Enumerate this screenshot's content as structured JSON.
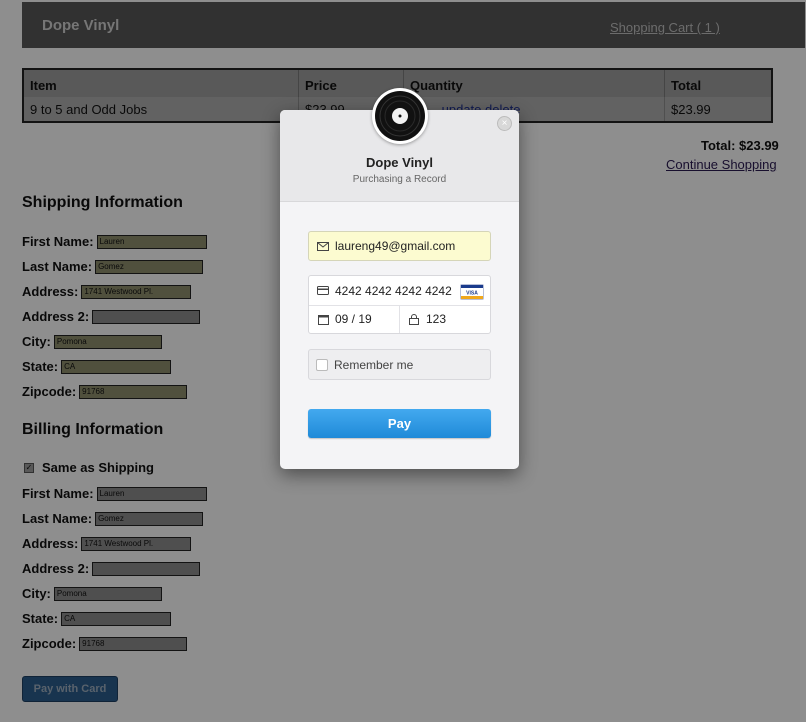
{
  "header": {
    "brand": "Dope Vinyl",
    "cart_link": "Shopping Cart ( 1 )"
  },
  "cart": {
    "columns": [
      "Item",
      "Price",
      "Quantity",
      "Total"
    ],
    "rows": [
      {
        "item": "9 to 5 and Odd Jobs",
        "price": "$23.99",
        "qty_update": "update",
        "qty_delete": "delete",
        "total": "$23.99"
      }
    ],
    "grand_total": "Total: $23.99",
    "continue_link": "Continue Shopping"
  },
  "shipping": {
    "title": "Shipping Information",
    "fields": [
      {
        "label": "First Name:",
        "value": "Lauren"
      },
      {
        "label": "Last Name:",
        "value": "Gomez"
      },
      {
        "label": "Address:",
        "value": "1741 Westwood Pl."
      },
      {
        "label": "Address 2:",
        "value": ""
      },
      {
        "label": "City:",
        "value": "Pomona"
      },
      {
        "label": "State:",
        "value": "CA"
      },
      {
        "label": "Zipcode:",
        "value": "91768"
      }
    ]
  },
  "billing": {
    "title": "Billing Information",
    "same_as_shipping": "Same as Shipping",
    "same_checked": true,
    "fields": [
      {
        "label": "First Name:",
        "value": "Lauren"
      },
      {
        "label": "Last Name:",
        "value": "Gomez"
      },
      {
        "label": "Address:",
        "value": "1741 Westwood Pl."
      },
      {
        "label": "Address 2:",
        "value": ""
      },
      {
        "label": "City:",
        "value": "Pomona"
      },
      {
        "label": "State:",
        "value": "CA"
      },
      {
        "label": "Zipcode:",
        "value": "91768"
      }
    ]
  },
  "pay_with_card": "Pay with Card",
  "checkout": {
    "title": "Dope Vinyl",
    "subtitle": "Purchasing a Record",
    "email": "laureng49@gmail.com",
    "card_number": "4242 4242 4242 4242",
    "expiry": "09 / 19",
    "cvc": "123",
    "remember_me": "Remember me",
    "pay_button": "Pay",
    "card_brand": "VISA"
  },
  "colors": {
    "pay_button": "#2a9be6",
    "email_bg": "#fcfbd0",
    "header_bg": "#333333"
  }
}
